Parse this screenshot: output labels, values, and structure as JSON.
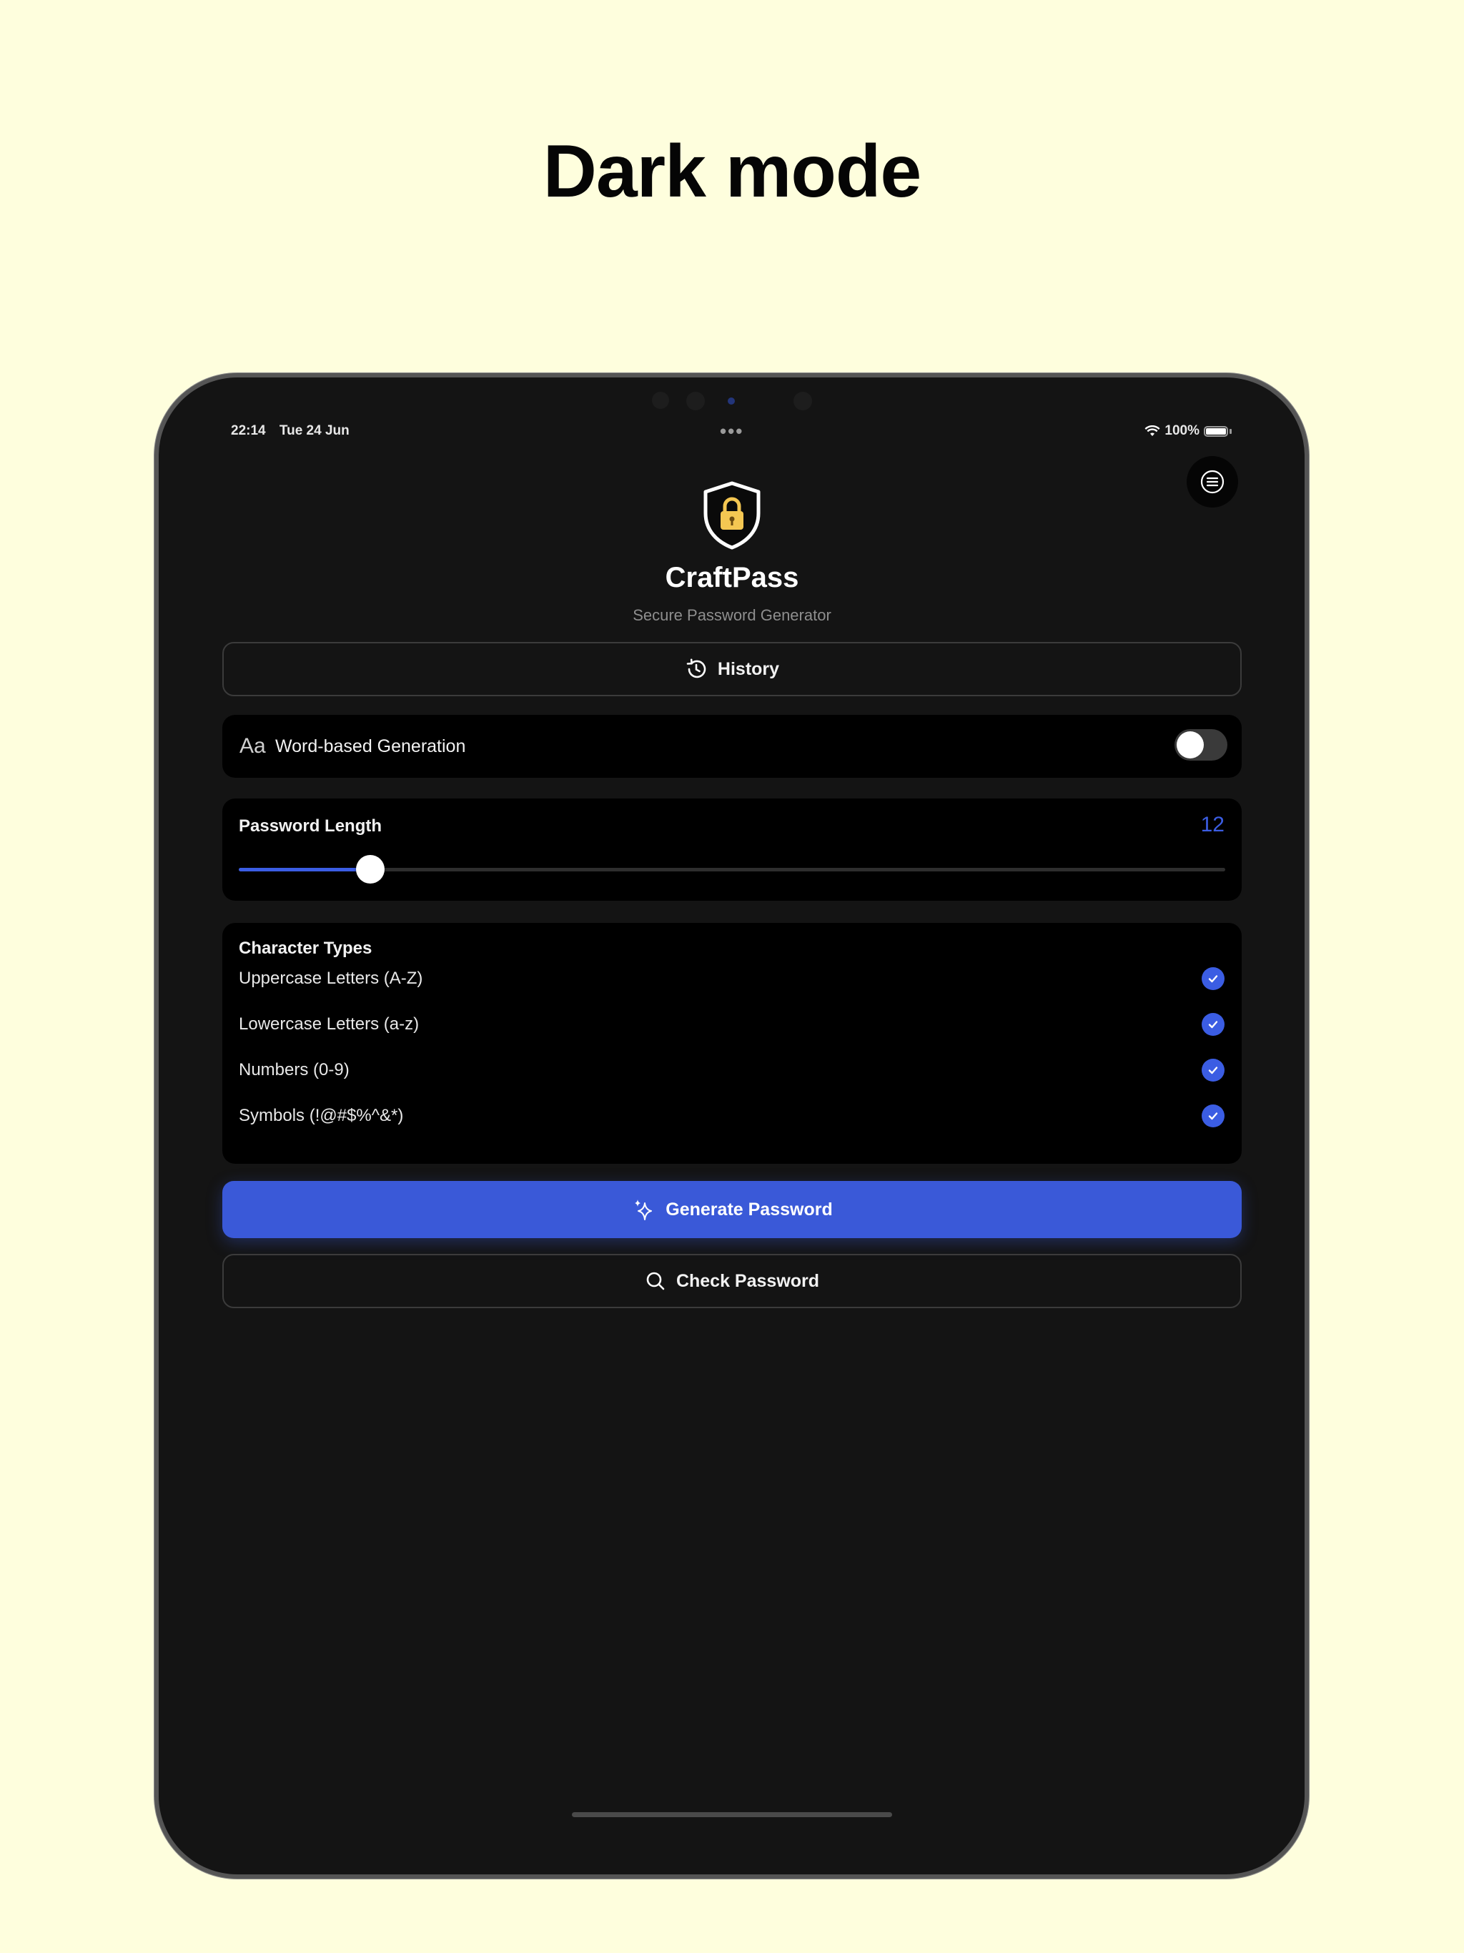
{
  "headline": "Dark mode",
  "status_bar": {
    "time": "22:14",
    "date": "Tue 24 Jun",
    "battery": "100%"
  },
  "app": {
    "title": "CraftPass",
    "subtitle": "Secure Password Generator"
  },
  "history_button": {
    "label": "History",
    "icon": "history-icon"
  },
  "word_generation": {
    "icon_text": "Aa",
    "label": "Word-based Generation",
    "enabled": false
  },
  "password_length": {
    "label": "Password Length",
    "value": "12",
    "min": 4,
    "max": 64,
    "current": 12
  },
  "character_types": {
    "heading": "Character Types",
    "items": [
      {
        "label": "Uppercase Letters (A-Z)",
        "checked": true
      },
      {
        "label": "Lowercase Letters (a-z)",
        "checked": true
      },
      {
        "label": "Numbers (0-9)",
        "checked": true
      },
      {
        "label": "Symbols (!@#$%^&*)",
        "checked": true
      }
    ]
  },
  "generate_button": {
    "label": "Generate Password",
    "icon": "sparkles-icon"
  },
  "check_button": {
    "label": "Check Password",
    "icon": "search-icon"
  },
  "colors": {
    "accent": "#3b5de3",
    "background": "#fefedd",
    "screen": "#141414",
    "card": "#000000"
  }
}
